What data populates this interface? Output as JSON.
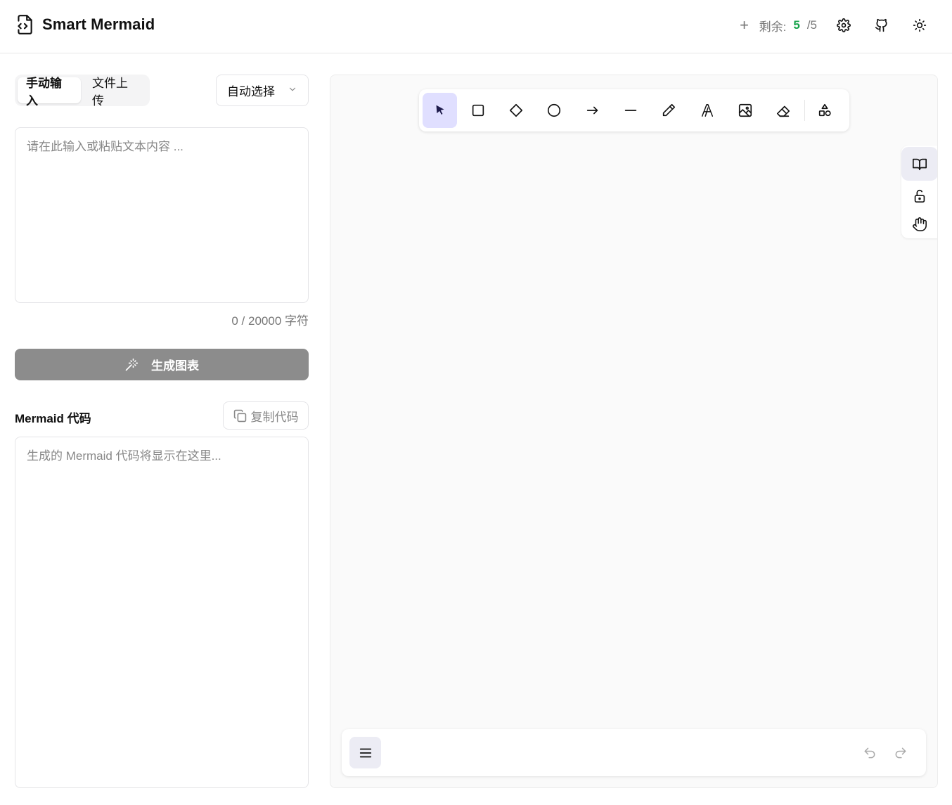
{
  "header": {
    "title": "Smart Mermaid",
    "quota_label": "剩余:",
    "quota_remaining": "5",
    "quota_total": "/5",
    "icons": [
      "file-code-icon",
      "plus-icon",
      "gear-icon",
      "github-icon",
      "sun-icon"
    ]
  },
  "input_panel": {
    "tabs": [
      {
        "label": "手动输入",
        "active": true
      },
      {
        "label": "文件上传",
        "active": false
      }
    ],
    "diagram_type": "自动选择",
    "text_placeholder": "请在此输入或粘贴文本内容 ...",
    "char_count": "0 / 20000 字符",
    "generate_label": "生成图表"
  },
  "code_panel": {
    "label": "Mermaid 代码",
    "copy_label": "复制代码",
    "placeholder": "生成的 Mermaid 代码将显示在这里..."
  },
  "canvas": {
    "tools": [
      "select-icon",
      "rectangle-icon",
      "diamond-icon",
      "ellipse-icon",
      "arrow-icon",
      "line-icon",
      "pencil-icon",
      "text-icon",
      "image-icon",
      "eraser-icon",
      "shapes-library-icon"
    ],
    "active_tool": "select-icon",
    "side_tools": [
      "library-icon",
      "unlock-icon",
      "hand-icon"
    ],
    "accent_color": "#e0dfff"
  }
}
